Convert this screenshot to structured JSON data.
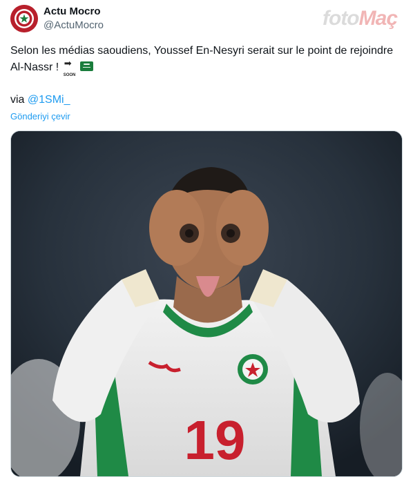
{
  "author": {
    "display_name": "Actu Mocro",
    "handle": "@ActuMocro"
  },
  "watermark": {
    "part1": "foto",
    "part2": "Maç"
  },
  "tweet": {
    "text": "Selon les médias saoudiens, Youssef En-Nesyri serait sur le point de rejoindre Al-Nassr !",
    "emoji_soon_label": "SOON",
    "via_prefix": "via",
    "via_mention": "@1SMi_",
    "translate_label": "Gönderiyi çevir"
  },
  "media": {
    "jersey_number": "19"
  },
  "icons": {
    "avatar": "moroccan-federation-crest-icon",
    "emoji_1": "soon-arrow-emoji",
    "emoji_2": "saudi-flag-emoji"
  },
  "colors": {
    "link": "#1d9bf0",
    "secondary_text": "#536471",
    "primary_text": "#0f1419",
    "avatar_bg": "#b8202c"
  }
}
